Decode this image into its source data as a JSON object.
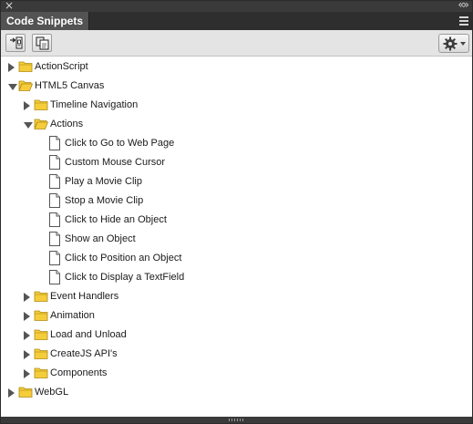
{
  "panel": {
    "tab_title": "Code Snippets",
    "close_glyph": "×",
    "collapse_glyph": "«»"
  },
  "toolbar": {
    "buttons": [
      {
        "name": "insert-snippet-icon"
      },
      {
        "name": "copy-to-clipboard-icon"
      }
    ],
    "options_icon": "gear-icon"
  },
  "tree": [
    {
      "label": "ActionScript",
      "type": "folder",
      "expanded": false,
      "level": 0
    },
    {
      "label": "HTML5 Canvas",
      "type": "folder",
      "expanded": true,
      "level": 0
    },
    {
      "label": "Timeline Navigation",
      "type": "folder",
      "expanded": false,
      "level": 1
    },
    {
      "label": "Actions",
      "type": "folder",
      "expanded": true,
      "level": 1
    },
    {
      "label": "Click to Go to Web Page",
      "type": "file",
      "level": 2
    },
    {
      "label": "Custom Mouse Cursor",
      "type": "file",
      "level": 2
    },
    {
      "label": "Play a Movie Clip",
      "type": "file",
      "level": 2
    },
    {
      "label": "Stop a Movie Clip",
      "type": "file",
      "level": 2
    },
    {
      "label": "Click to Hide an Object",
      "type": "file",
      "level": 2
    },
    {
      "label": "Show an Object",
      "type": "file",
      "level": 2
    },
    {
      "label": "Click to Position an Object",
      "type": "file",
      "level": 2
    },
    {
      "label": "Click to Display a TextField",
      "type": "file",
      "level": 2
    },
    {
      "label": "Event Handlers",
      "type": "folder",
      "expanded": false,
      "level": 1
    },
    {
      "label": "Animation",
      "type": "folder",
      "expanded": false,
      "level": 1
    },
    {
      "label": "Load and Unload",
      "type": "folder",
      "expanded": false,
      "level": 1
    },
    {
      "label": "CreateJS API's",
      "type": "folder",
      "expanded": false,
      "level": 1
    },
    {
      "label": "Components",
      "type": "folder",
      "expanded": false,
      "level": 1
    },
    {
      "label": "WebGL",
      "type": "folder",
      "expanded": false,
      "level": 0
    }
  ],
  "colors": {
    "folder_fill": "#f5cd3a",
    "folder_stroke": "#b08a14",
    "tab_bg": "#535353",
    "panel_dark": "#2e2e2e"
  }
}
